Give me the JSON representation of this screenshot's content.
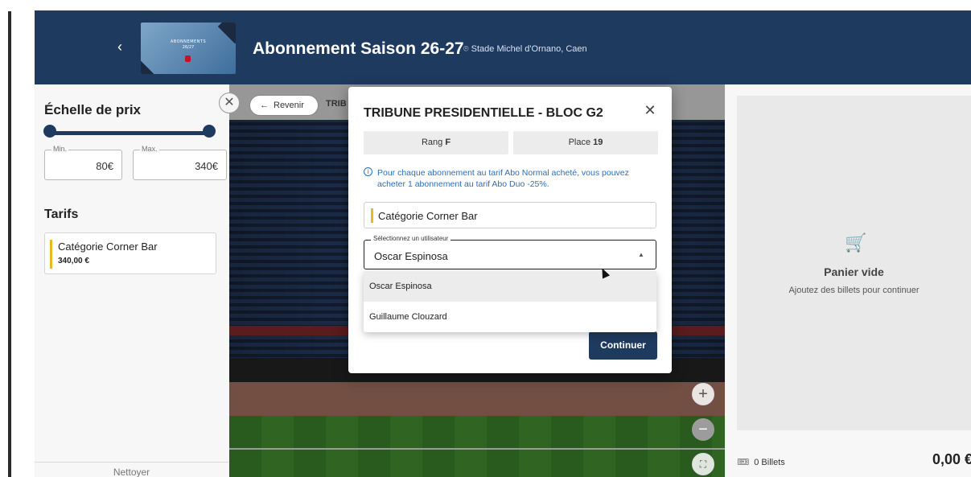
{
  "header": {
    "back_icon": "chevron-left-icon",
    "thumb_line1": "ABONNEMENTS",
    "thumb_line2": "26/27",
    "title": "Abonnement Saison 26-27",
    "venue": "Stade Michel d'Ornano, Caen"
  },
  "sidebar": {
    "price_title": "Échelle de prix",
    "min_label": "Min.",
    "min_value": "80€",
    "max_label": "Max.",
    "max_value": "340€",
    "tarifs_title": "Tarifs",
    "tarif": {
      "name": "Catégorie Corner Bar",
      "price": "340,00 €"
    },
    "reset_label": "Nettoyer"
  },
  "map": {
    "back_label": "Revenir",
    "breadcrumb": "TRIB"
  },
  "cart": {
    "empty_title": "Panier vide",
    "empty_hint": "Ajoutez des billets pour continuer",
    "tickets_label": "0 Billets",
    "total": "0,00 €"
  },
  "modal": {
    "title": "TRIBUNE PRESIDENTIELLE - BLOC G2",
    "rang_label": "Rang",
    "rang_value": "F",
    "place_label": "Place",
    "place_value": "19",
    "info_text": "Pour chaque abonnement au tarif Abo Normal acheté, vous pouvez acheter 1 abonnement au tarif Abo Duo -25%.",
    "category": "Catégorie Corner Bar",
    "select_label": "Sélectionnez un utilisateur",
    "select_value": "Oscar Espinosa",
    "options": [
      "Oscar Espinosa",
      "Guillaume Clouzard"
    ],
    "continue_label": "Continuer"
  },
  "colors": {
    "brand": "#1f3a5f",
    "accent": "#e8b923",
    "info": "#2a6ebb"
  }
}
